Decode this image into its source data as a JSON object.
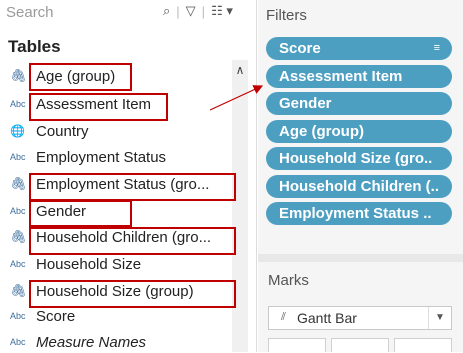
{
  "search": {
    "placeholder": "Search"
  },
  "tables": {
    "heading": "Tables",
    "fields": [
      {
        "label": "Age (group)",
        "icon": "paperclip-icon"
      },
      {
        "label": "Assessment Item",
        "icon": "abc-icon"
      },
      {
        "label": "Country",
        "icon": "globe-icon"
      },
      {
        "label": "Employment Status",
        "icon": "abc-icon"
      },
      {
        "label": "Employment Status (gro...",
        "icon": "paperclip-icon"
      },
      {
        "label": "Gender",
        "icon": "abc-icon"
      },
      {
        "label": "Household Children (gro...",
        "icon": "paperclip-icon"
      },
      {
        "label": "Household Size",
        "icon": "abc-icon"
      },
      {
        "label": "Household Size (group)",
        "icon": "paperclip-icon"
      },
      {
        "label": "Score",
        "icon": "abc-icon"
      },
      {
        "label": "Measure Names",
        "icon": "abc-icon"
      }
    ],
    "icon_text": {
      "abc": "Abc"
    }
  },
  "filters": {
    "heading": "Filters",
    "pills": [
      "Score",
      "Assessment Item",
      "Gender",
      "Age (group)",
      "Household Size (gro..",
      "Household Children (..",
      "Employment Status .."
    ]
  },
  "marks": {
    "heading": "Marks",
    "type": "Gantt Bar"
  },
  "colors": {
    "pill": "#4d9fc2",
    "highlight": "#c00000"
  }
}
